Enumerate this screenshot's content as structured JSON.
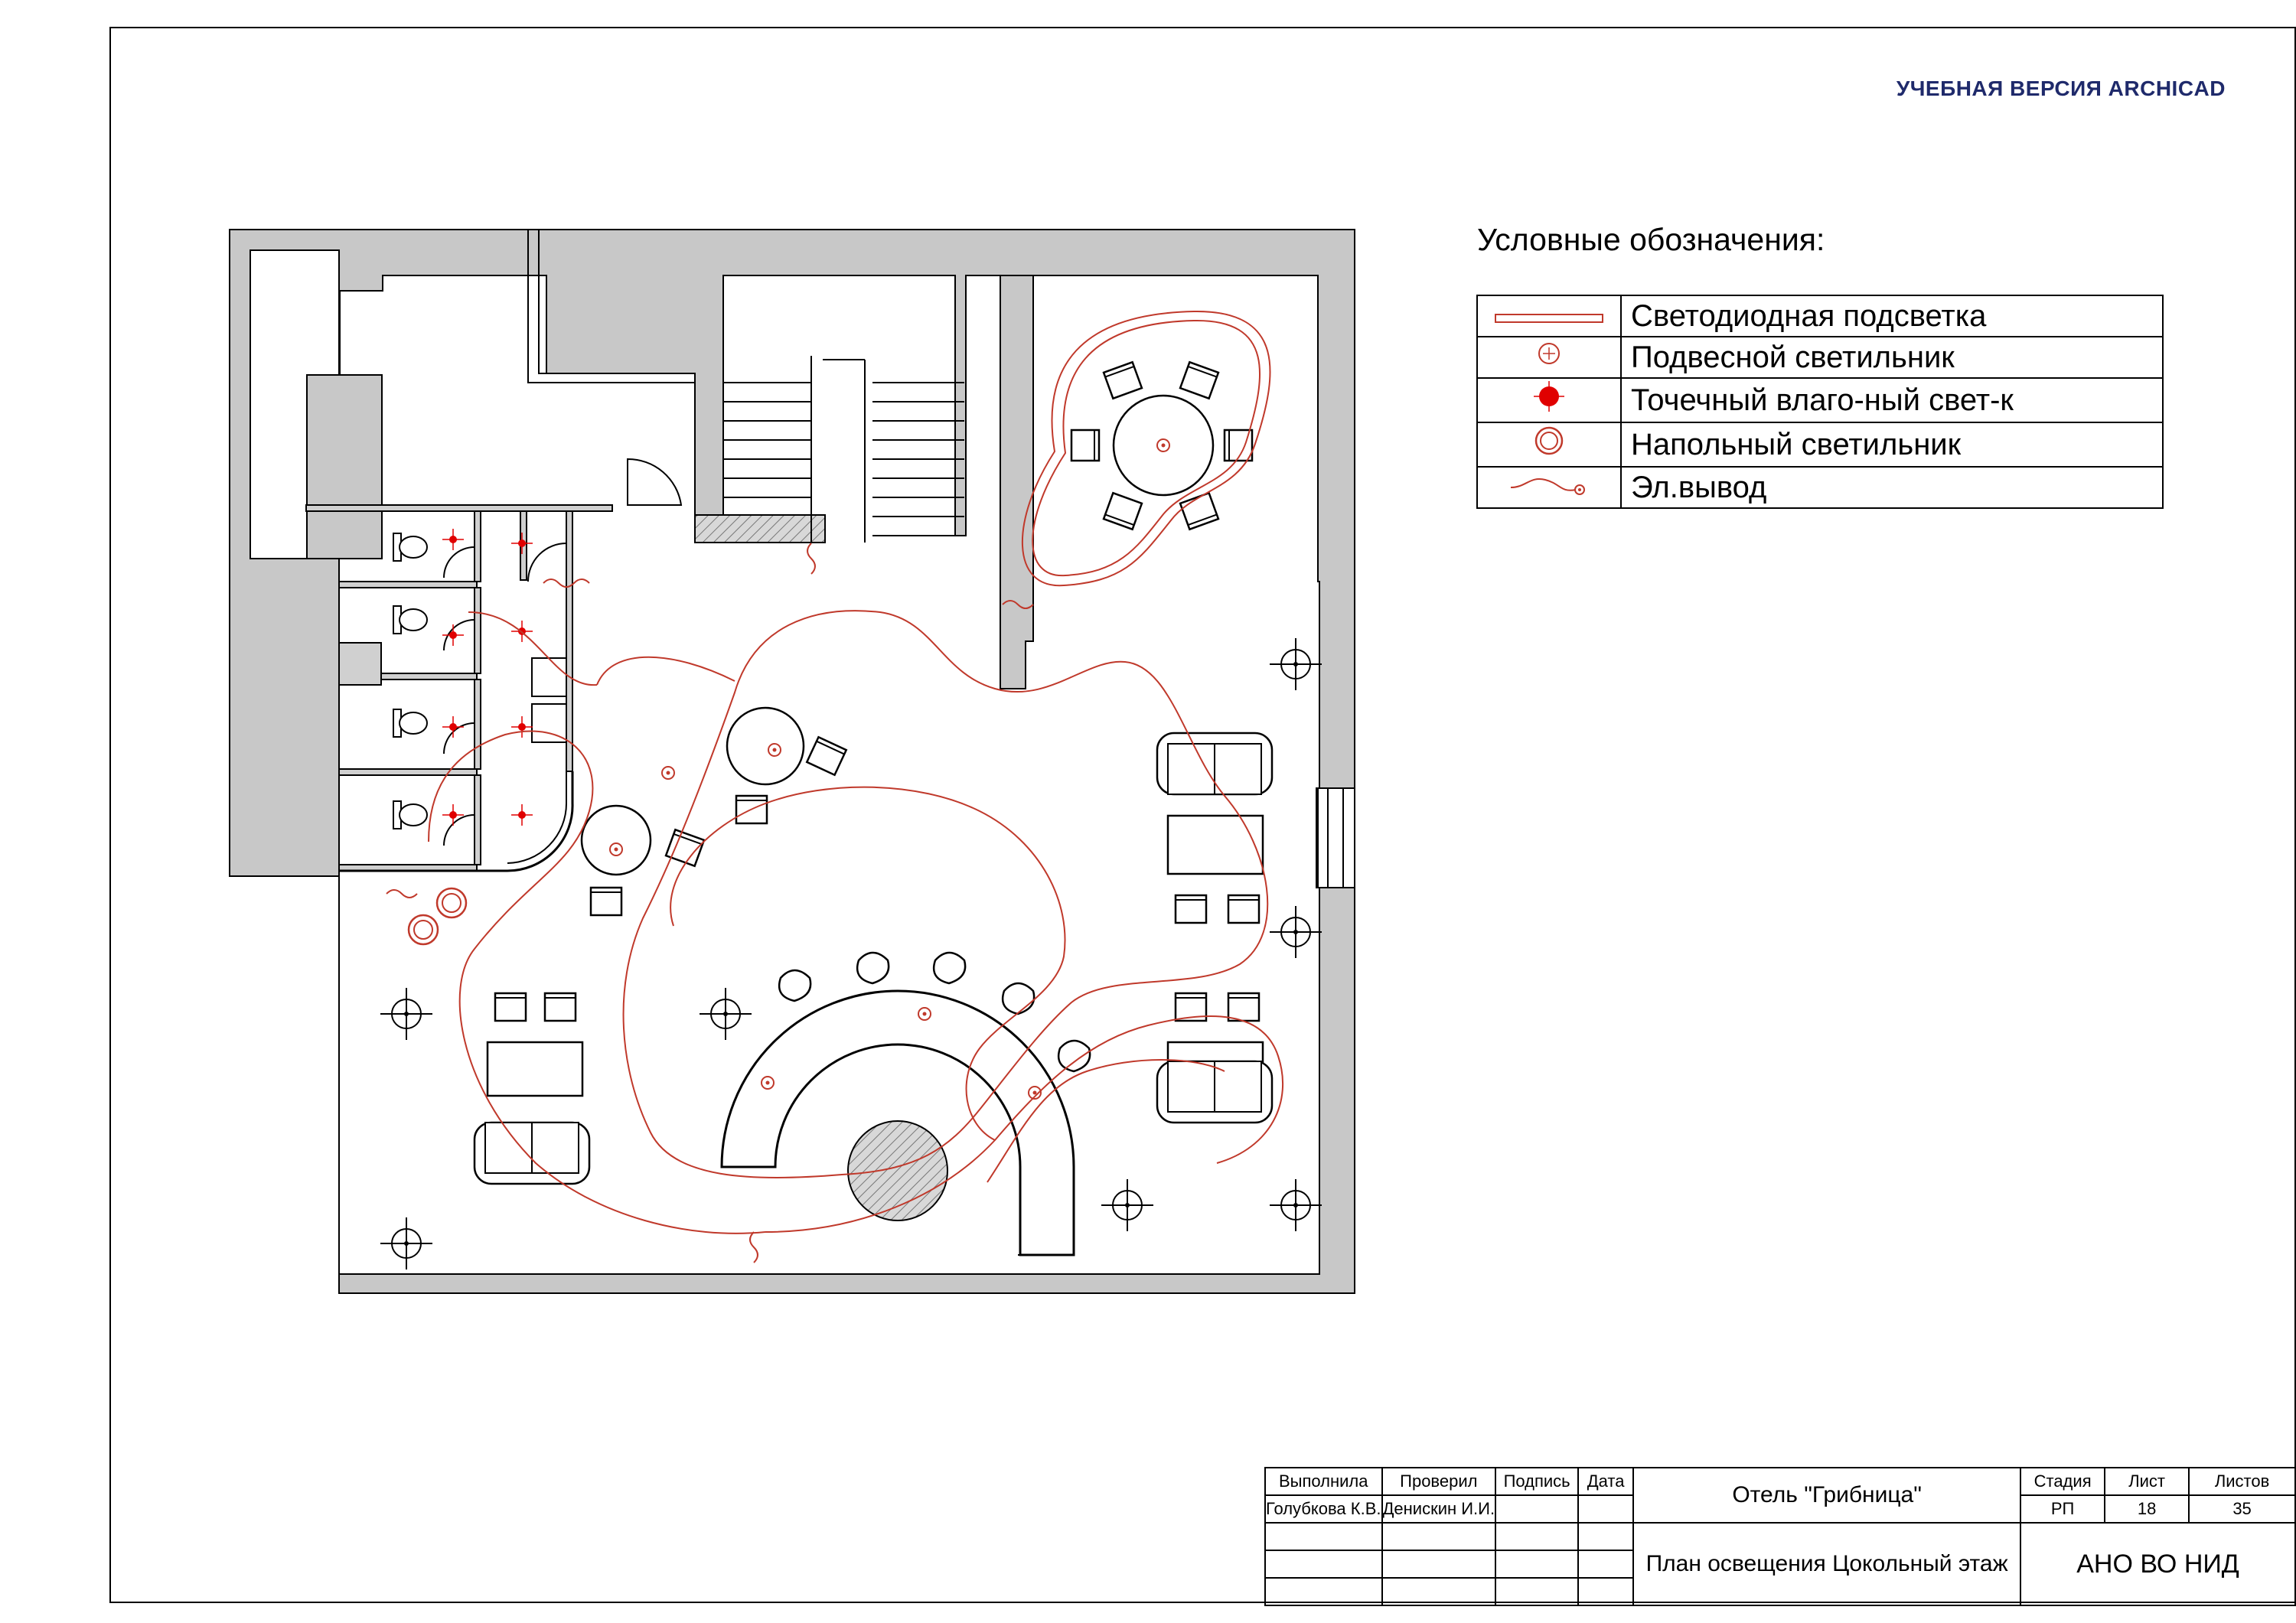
{
  "watermark": "УЧЕБНАЯ ВЕРСИЯ ARCHICAD",
  "legend": {
    "title": "Условные обозначения:",
    "items": [
      {
        "icon": "led-strip-icon",
        "label": "Светодиодная подсветка"
      },
      {
        "icon": "pendant-light-icon",
        "label": "Подвесной светильник"
      },
      {
        "icon": "moisture-spotlight-icon",
        "label": "Точечный влаго-ный свет-к"
      },
      {
        "icon": "floor-lamp-icon",
        "label": "Напольный светильник"
      },
      {
        "icon": "electric-outlet-icon",
        "label": "Эл.вывод"
      }
    ]
  },
  "stamp": {
    "headers": {
      "done_by": "Выполнила",
      "checked": "Проверил",
      "signature": "Подпись",
      "date": "Дата",
      "stage": "Стадия",
      "sheet": "Лист",
      "sheets": "Листов"
    },
    "done_by_name": "Голубкова К.В.",
    "checked_name": "Денискин И.И.",
    "project": "Отель \"Грибница\"",
    "drawing_title": "План освещения Цокольный этаж",
    "stage": "РП",
    "sheet": "18",
    "sheets": "35",
    "organization": "АНО ВО НИД"
  },
  "colors": {
    "wall": "#c8c8c8",
    "led": "#c0392b",
    "spot": "#e00000",
    "text": "#000000",
    "watermark": "#1f2a6b"
  }
}
